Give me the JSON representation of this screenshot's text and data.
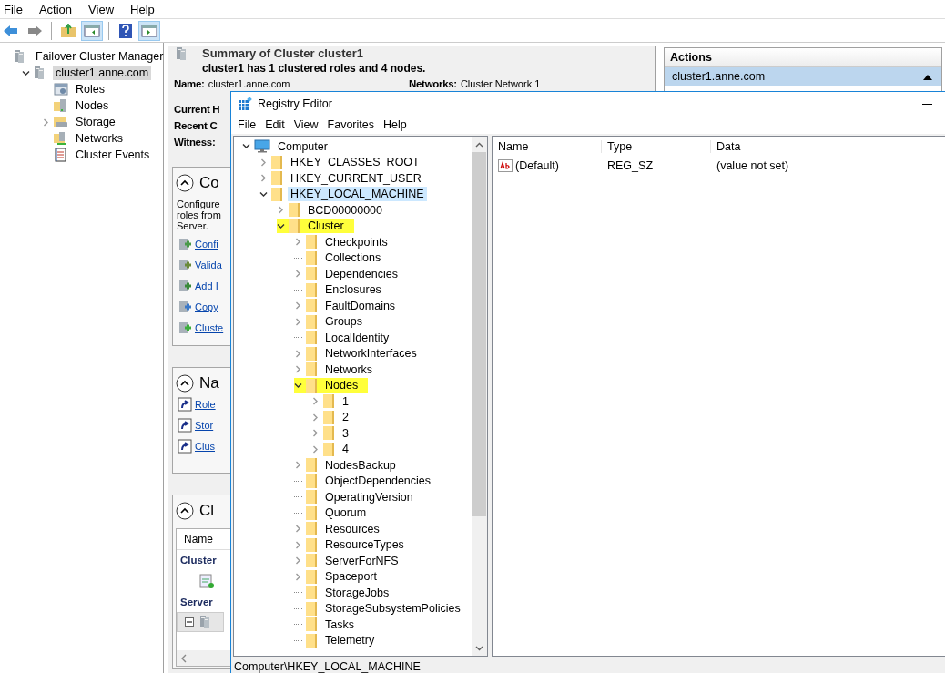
{
  "fcm": {
    "menu": [
      "File",
      "Action",
      "View",
      "Help"
    ],
    "toolbar": [
      {
        "kind": "back",
        "on": false
      },
      {
        "kind": "forward",
        "on": false
      },
      {
        "kind": "separator"
      },
      {
        "kind": "up",
        "on": false
      },
      {
        "kind": "pane-left",
        "on": true
      },
      {
        "kind": "separator"
      },
      {
        "kind": "help",
        "on": false
      },
      {
        "kind": "pane-right",
        "on": true
      }
    ],
    "tree": {
      "label": "Failover Cluster Manager",
      "kind": "manager",
      "selected": false,
      "children": [
        {
          "label": "cluster1.anne.com",
          "kind": "cluster",
          "selected": true,
          "expanded": true,
          "children": [
            {
              "label": "Roles",
              "kind": "roles",
              "selected": false
            },
            {
              "label": "Nodes",
              "kind": "nodes",
              "selected": false
            },
            {
              "label": "Storage",
              "kind": "storage",
              "selected": false,
              "expanded": false
            },
            {
              "label": "Networks",
              "kind": "networks",
              "selected": false
            },
            {
              "label": "Cluster Events",
              "kind": "events",
              "selected": false
            }
          ]
        }
      ]
    },
    "summary": {
      "title": "Summary of Cluster cluster1",
      "subtitle": "cluster1 has 1 clustered roles and 4 nodes.",
      "info_rows": [
        [
          {
            "label": "Name:",
            "value": "cluster1.anne.com"
          },
          {
            "label": "Networks:",
            "value": "Cluster Network 1"
          }
        ],
        [
          {
            "label": "Current H"
          }
        ],
        [
          {
            "label": "Recent C"
          }
        ],
        [
          {
            "label": "Witness:"
          }
        ]
      ],
      "sections": [
        {
          "title": "Co",
          "expanded": true,
          "description_lines": [
            "Configure",
            "roles from",
            "Server."
          ],
          "links": [
            "Confi",
            "Valida",
            "Add I",
            "Copy",
            "Cluste"
          ]
        },
        {
          "title": "Na",
          "expanded": true,
          "links": [
            "Role",
            "Stor",
            "Clus"
          ]
        },
        {
          "title": "Cl",
          "expanded": true,
          "table": {
            "column": "Name",
            "groups": [
              "Cluster",
              "Server"
            ]
          }
        }
      ]
    },
    "actions": {
      "title": "Actions",
      "items": [
        {
          "label": "cluster1.anne.com",
          "selected": true
        }
      ]
    }
  },
  "regedit": {
    "title": "Registry Editor",
    "menu": [
      "File",
      "Edit",
      "View",
      "Favorites",
      "Help"
    ],
    "tree": [
      {
        "label": "Computer",
        "kind": "computer",
        "expanded": true,
        "selected": false,
        "highlighted": false,
        "children": [
          {
            "label": "HKEY_CLASSES_ROOT",
            "expanded": false,
            "selected": false,
            "highlighted": false
          },
          {
            "label": "HKEY_CURRENT_USER",
            "expanded": false,
            "selected": false,
            "highlighted": false
          },
          {
            "label": "HKEY_LOCAL_MACHINE",
            "expanded": true,
            "selected": true,
            "highlighted": false,
            "children": [
              {
                "label": "BCD00000000",
                "expanded": false,
                "selected": false,
                "highlighted": false
              },
              {
                "label": "Cluster",
                "expanded": true,
                "selected": false,
                "highlighted": true,
                "children": [
                  {
                    "label": "Checkpoints",
                    "expanded": false,
                    "selected": false,
                    "highlighted": false
                  },
                  {
                    "label": "Collections",
                    "selected": false,
                    "highlighted": false
                  },
                  {
                    "label": "Dependencies",
                    "expanded": false,
                    "selected": false,
                    "highlighted": false
                  },
                  {
                    "label": "Enclosures",
                    "selected": false,
                    "highlighted": false
                  },
                  {
                    "label": "FaultDomains",
                    "expanded": false,
                    "selected": false,
                    "highlighted": false
                  },
                  {
                    "label": "Groups",
                    "expanded": false,
                    "selected": false,
                    "highlighted": false
                  },
                  {
                    "label": "LocalIdentity",
                    "selected": false,
                    "highlighted": false
                  },
                  {
                    "label": "NetworkInterfaces",
                    "expanded": false,
                    "selected": false,
                    "highlighted": false
                  },
                  {
                    "label": "Networks",
                    "expanded": false,
                    "selected": false,
                    "highlighted": false
                  },
                  {
                    "label": "Nodes",
                    "expanded": true,
                    "selected": false,
                    "highlighted": true,
                    "children": [
                      {
                        "label": "1",
                        "expanded": false,
                        "selected": false,
                        "highlighted": false
                      },
                      {
                        "label": "2",
                        "expanded": false,
                        "selected": false,
                        "highlighted": false
                      },
                      {
                        "label": "3",
                        "expanded": false,
                        "selected": false,
                        "highlighted": false
                      },
                      {
                        "label": "4",
                        "expanded": false,
                        "selected": false,
                        "highlighted": false
                      }
                    ]
                  },
                  {
                    "label": "NodesBackup",
                    "expanded": false,
                    "selected": false,
                    "highlighted": false
                  },
                  {
                    "label": "ObjectDependencies",
                    "selected": false,
                    "highlighted": false
                  },
                  {
                    "label": "OperatingVersion",
                    "selected": false,
                    "highlighted": false
                  },
                  {
                    "label": "Quorum",
                    "selected": false,
                    "highlighted": false
                  },
                  {
                    "label": "Resources",
                    "expanded": false,
                    "selected": false,
                    "highlighted": false
                  },
                  {
                    "label": "ResourceTypes",
                    "expanded": false,
                    "selected": false,
                    "highlighted": false
                  },
                  {
                    "label": "ServerForNFS",
                    "expanded": false,
                    "selected": false,
                    "highlighted": false
                  },
                  {
                    "label": "Spaceport",
                    "expanded": false,
                    "selected": false,
                    "highlighted": false
                  },
                  {
                    "label": "StorageJobs",
                    "selected": false,
                    "highlighted": false
                  },
                  {
                    "label": "StorageSubsystemPolicies",
                    "selected": false,
                    "highlighted": false
                  },
                  {
                    "label": "Tasks",
                    "selected": false,
                    "highlighted": false
                  },
                  {
                    "label": "Telemetry",
                    "selected": false,
                    "highlighted": false
                  }
                ]
              }
            ]
          }
        ]
      }
    ],
    "columns": [
      "Name",
      "Type",
      "Data"
    ],
    "values": [
      {
        "name": "(Default)",
        "type": "REG_SZ",
        "data": "(value not set)",
        "kind": "string"
      }
    ],
    "status": "Computer\\HKEY_LOCAL_MACHINE"
  }
}
